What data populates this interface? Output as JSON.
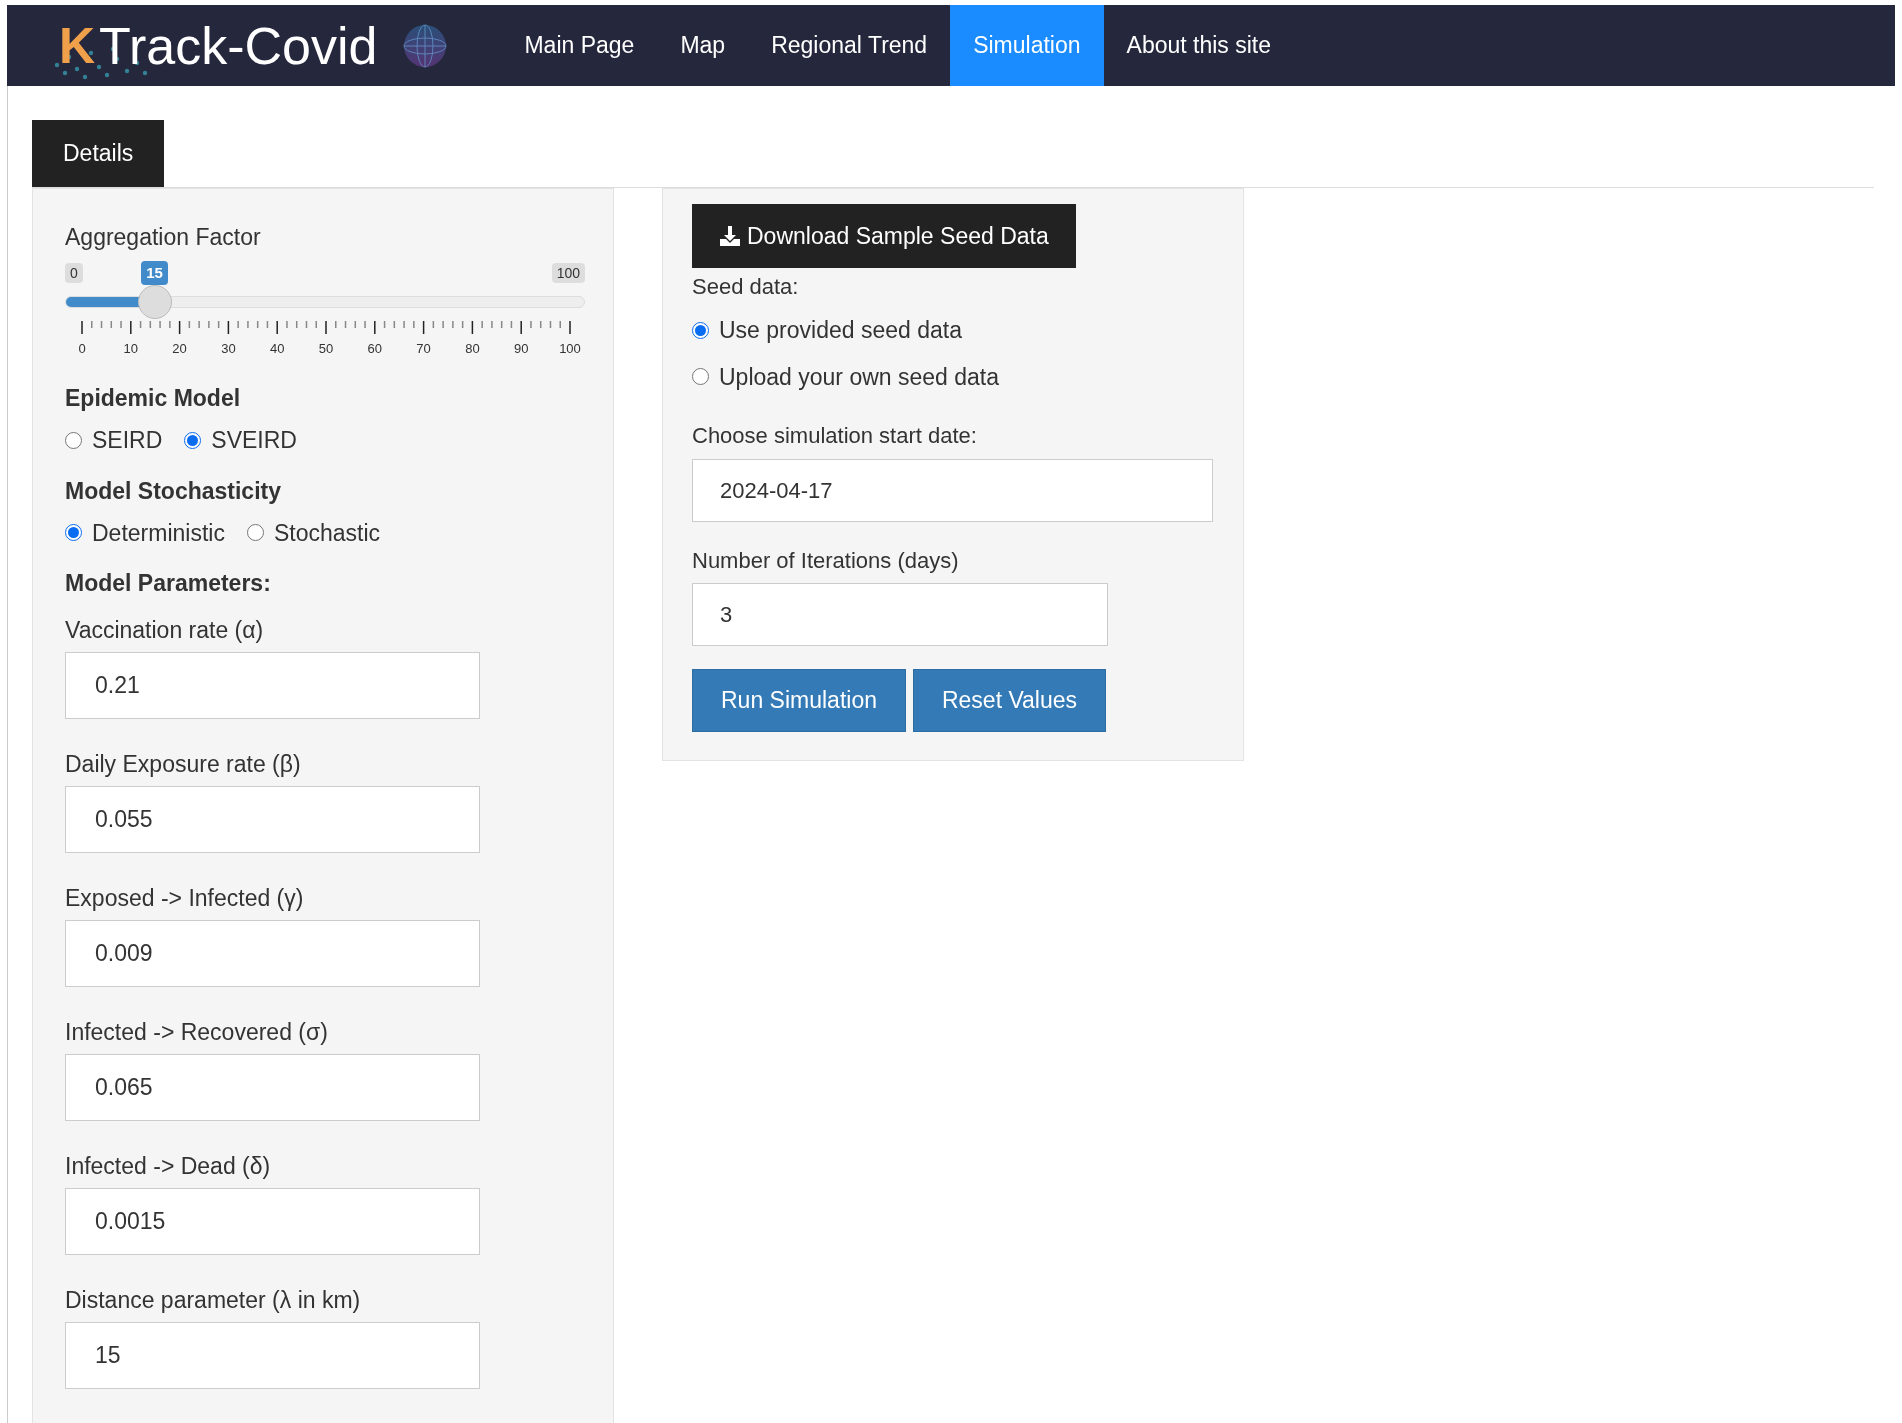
{
  "brand": {
    "letter": "K",
    "title": "Track-Covid"
  },
  "nav": [
    {
      "label": "Main Page",
      "selected": false
    },
    {
      "label": "Map",
      "selected": false
    },
    {
      "label": "Regional Trend",
      "selected": false
    },
    {
      "label": "Simulation",
      "selected": true
    },
    {
      "label": "About this site",
      "selected": false
    }
  ],
  "tabs": [
    {
      "label": "Details",
      "selected": true
    }
  ],
  "left_panel": {
    "slider": {
      "label": "Aggregation Factor",
      "min": "0",
      "max": "100",
      "value": "15",
      "level": 0.15,
      "ticks": [
        "0",
        "10",
        "20",
        "30",
        "40",
        "50",
        "60",
        "70",
        "80",
        "90",
        "100"
      ]
    },
    "radio_groups": [
      {
        "title": "Epidemic Model",
        "options": [
          {
            "label": "SEIRD",
            "selected": false
          },
          {
            "label": "SVEIRD",
            "selected": true
          }
        ]
      },
      {
        "title": "Model Stochasticity",
        "options": [
          {
            "label": "Deterministic",
            "selected": true
          },
          {
            "label": "Stochastic",
            "selected": false
          }
        ]
      }
    ],
    "params_title": "Model Parameters:",
    "fields": [
      {
        "label": "Vaccination rate (α)",
        "value": "0.21"
      },
      {
        "label": "Daily Exposure rate (β)",
        "value": "0.055"
      },
      {
        "label": "Exposed -> Infected (γ)",
        "value": "0.009"
      },
      {
        "label": "Infected -> Recovered (σ)",
        "value": "0.065"
      },
      {
        "label": "Infected -> Dead (δ)",
        "value": "0.0015"
      },
      {
        "label": "Distance parameter (λ in km)",
        "value": "15"
      }
    ]
  },
  "right_panel": {
    "download_button": "Download Sample Seed Data",
    "seed_label": "Seed data:",
    "seed_options": [
      {
        "label": "Use provided seed data",
        "selected": true
      },
      {
        "label": "Upload your own seed data",
        "selected": false
      }
    ],
    "start_date": {
      "label": "Choose simulation start date:",
      "value": "2024-04-17"
    },
    "iterations": {
      "label": "Number of Iterations (days)",
      "value": "3"
    },
    "buttons": [
      "Run Simulation",
      "Reset Values"
    ]
  }
}
